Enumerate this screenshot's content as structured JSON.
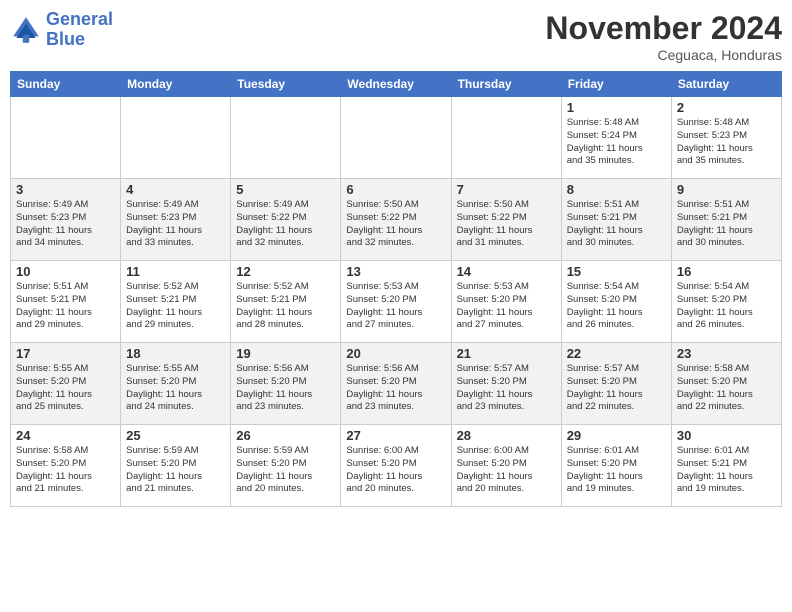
{
  "header": {
    "logo_line1": "General",
    "logo_line2": "Blue",
    "month": "November 2024",
    "location": "Ceguaca, Honduras"
  },
  "days_of_week": [
    "Sunday",
    "Monday",
    "Tuesday",
    "Wednesday",
    "Thursday",
    "Friday",
    "Saturday"
  ],
  "weeks": [
    [
      {
        "day": "",
        "info": ""
      },
      {
        "day": "",
        "info": ""
      },
      {
        "day": "",
        "info": ""
      },
      {
        "day": "",
        "info": ""
      },
      {
        "day": "",
        "info": ""
      },
      {
        "day": "1",
        "info": "Sunrise: 5:48 AM\nSunset: 5:24 PM\nDaylight: 11 hours\nand 35 minutes."
      },
      {
        "day": "2",
        "info": "Sunrise: 5:48 AM\nSunset: 5:23 PM\nDaylight: 11 hours\nand 35 minutes."
      }
    ],
    [
      {
        "day": "3",
        "info": "Sunrise: 5:49 AM\nSunset: 5:23 PM\nDaylight: 11 hours\nand 34 minutes."
      },
      {
        "day": "4",
        "info": "Sunrise: 5:49 AM\nSunset: 5:23 PM\nDaylight: 11 hours\nand 33 minutes."
      },
      {
        "day": "5",
        "info": "Sunrise: 5:49 AM\nSunset: 5:22 PM\nDaylight: 11 hours\nand 32 minutes."
      },
      {
        "day": "6",
        "info": "Sunrise: 5:50 AM\nSunset: 5:22 PM\nDaylight: 11 hours\nand 32 minutes."
      },
      {
        "day": "7",
        "info": "Sunrise: 5:50 AM\nSunset: 5:22 PM\nDaylight: 11 hours\nand 31 minutes."
      },
      {
        "day": "8",
        "info": "Sunrise: 5:51 AM\nSunset: 5:21 PM\nDaylight: 11 hours\nand 30 minutes."
      },
      {
        "day": "9",
        "info": "Sunrise: 5:51 AM\nSunset: 5:21 PM\nDaylight: 11 hours\nand 30 minutes."
      }
    ],
    [
      {
        "day": "10",
        "info": "Sunrise: 5:51 AM\nSunset: 5:21 PM\nDaylight: 11 hours\nand 29 minutes."
      },
      {
        "day": "11",
        "info": "Sunrise: 5:52 AM\nSunset: 5:21 PM\nDaylight: 11 hours\nand 29 minutes."
      },
      {
        "day": "12",
        "info": "Sunrise: 5:52 AM\nSunset: 5:21 PM\nDaylight: 11 hours\nand 28 minutes."
      },
      {
        "day": "13",
        "info": "Sunrise: 5:53 AM\nSunset: 5:20 PM\nDaylight: 11 hours\nand 27 minutes."
      },
      {
        "day": "14",
        "info": "Sunrise: 5:53 AM\nSunset: 5:20 PM\nDaylight: 11 hours\nand 27 minutes."
      },
      {
        "day": "15",
        "info": "Sunrise: 5:54 AM\nSunset: 5:20 PM\nDaylight: 11 hours\nand 26 minutes."
      },
      {
        "day": "16",
        "info": "Sunrise: 5:54 AM\nSunset: 5:20 PM\nDaylight: 11 hours\nand 26 minutes."
      }
    ],
    [
      {
        "day": "17",
        "info": "Sunrise: 5:55 AM\nSunset: 5:20 PM\nDaylight: 11 hours\nand 25 minutes."
      },
      {
        "day": "18",
        "info": "Sunrise: 5:55 AM\nSunset: 5:20 PM\nDaylight: 11 hours\nand 24 minutes."
      },
      {
        "day": "19",
        "info": "Sunrise: 5:56 AM\nSunset: 5:20 PM\nDaylight: 11 hours\nand 23 minutes."
      },
      {
        "day": "20",
        "info": "Sunrise: 5:56 AM\nSunset: 5:20 PM\nDaylight: 11 hours\nand 23 minutes."
      },
      {
        "day": "21",
        "info": "Sunrise: 5:57 AM\nSunset: 5:20 PM\nDaylight: 11 hours\nand 23 minutes."
      },
      {
        "day": "22",
        "info": "Sunrise: 5:57 AM\nSunset: 5:20 PM\nDaylight: 11 hours\nand 22 minutes."
      },
      {
        "day": "23",
        "info": "Sunrise: 5:58 AM\nSunset: 5:20 PM\nDaylight: 11 hours\nand 22 minutes."
      }
    ],
    [
      {
        "day": "24",
        "info": "Sunrise: 5:58 AM\nSunset: 5:20 PM\nDaylight: 11 hours\nand 21 minutes."
      },
      {
        "day": "25",
        "info": "Sunrise: 5:59 AM\nSunset: 5:20 PM\nDaylight: 11 hours\nand 21 minutes."
      },
      {
        "day": "26",
        "info": "Sunrise: 5:59 AM\nSunset: 5:20 PM\nDaylight: 11 hours\nand 20 minutes."
      },
      {
        "day": "27",
        "info": "Sunrise: 6:00 AM\nSunset: 5:20 PM\nDaylight: 11 hours\nand 20 minutes."
      },
      {
        "day": "28",
        "info": "Sunrise: 6:00 AM\nSunset: 5:20 PM\nDaylight: 11 hours\nand 20 minutes."
      },
      {
        "day": "29",
        "info": "Sunrise: 6:01 AM\nSunset: 5:20 PM\nDaylight: 11 hours\nand 19 minutes."
      },
      {
        "day": "30",
        "info": "Sunrise: 6:01 AM\nSunset: 5:21 PM\nDaylight: 11 hours\nand 19 minutes."
      }
    ]
  ]
}
